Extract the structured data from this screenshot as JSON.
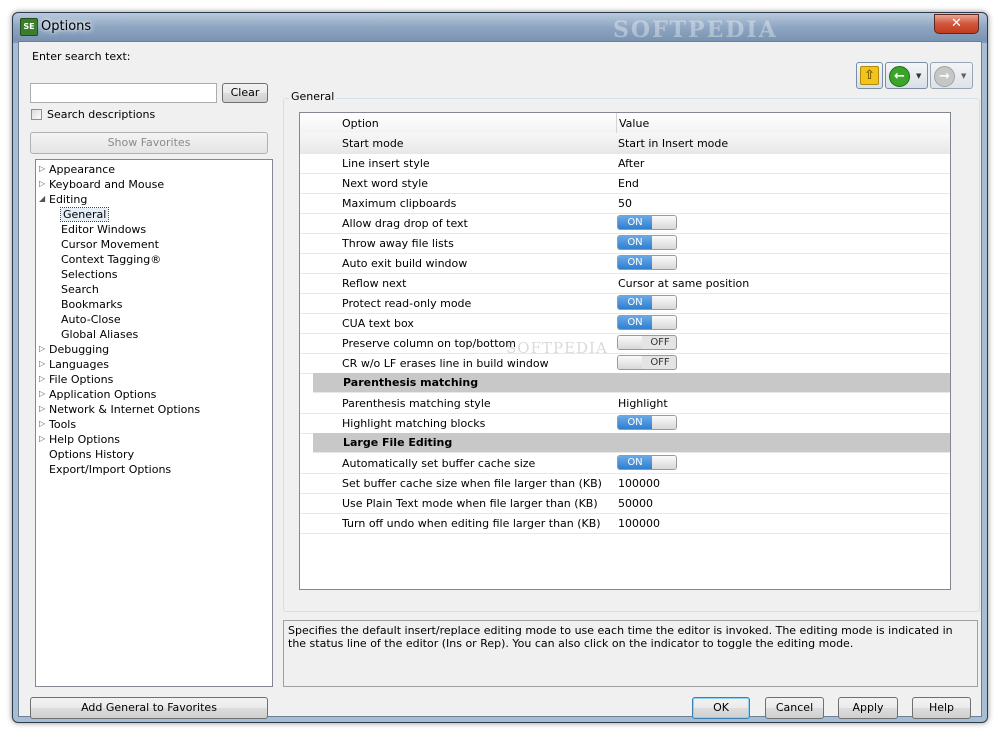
{
  "window": {
    "title": "Options",
    "icon_text": "SE",
    "watermark": "SOFTPEDIA",
    "close_glyph": "✕"
  },
  "search": {
    "label": "Enter search text:",
    "value": "",
    "clear_label": "Clear",
    "descriptions_label": "Search descriptions",
    "descriptions_checked": false
  },
  "show_favorites_label": "Show Favorites",
  "add_favorites_label": "Add General to Favorites",
  "tree": {
    "items": [
      {
        "label": "Appearance",
        "level": 0,
        "state": "collapsed"
      },
      {
        "label": "Keyboard and Mouse",
        "level": 0,
        "state": "collapsed"
      },
      {
        "label": "Editing",
        "level": 0,
        "state": "expanded"
      },
      {
        "label": "General",
        "level": 1,
        "state": "leaf",
        "selected": true
      },
      {
        "label": "Editor Windows",
        "level": 1,
        "state": "leaf"
      },
      {
        "label": "Cursor Movement",
        "level": 1,
        "state": "leaf"
      },
      {
        "label": "Context Tagging®",
        "level": 1,
        "state": "leaf"
      },
      {
        "label": "Selections",
        "level": 1,
        "state": "leaf"
      },
      {
        "label": "Search",
        "level": 1,
        "state": "leaf"
      },
      {
        "label": "Bookmarks",
        "level": 1,
        "state": "leaf"
      },
      {
        "label": "Auto-Close",
        "level": 1,
        "state": "leaf"
      },
      {
        "label": "Global Aliases",
        "level": 1,
        "state": "leaf"
      },
      {
        "label": "Debugging",
        "level": 0,
        "state": "collapsed"
      },
      {
        "label": "Languages",
        "level": 0,
        "state": "collapsed"
      },
      {
        "label": "File Options",
        "level": 0,
        "state": "collapsed"
      },
      {
        "label": "Application Options",
        "level": 0,
        "state": "collapsed"
      },
      {
        "label": "Network & Internet Options",
        "level": 0,
        "state": "collapsed"
      },
      {
        "label": "Tools",
        "level": 0,
        "state": "collapsed"
      },
      {
        "label": "Help Options",
        "level": 0,
        "state": "collapsed"
      },
      {
        "label": "Options History",
        "level": 0,
        "state": "leaf"
      },
      {
        "label": "Export/Import Options",
        "level": 0,
        "state": "leaf"
      }
    ]
  },
  "nav": {
    "up_icon": "up-arrow-icon",
    "back_icon": "back-arrow-icon",
    "forward_icon": "forward-arrow-icon",
    "up_glyph": "⇧",
    "back_glyph": "←",
    "forward_glyph": "→",
    "dropdown_glyph": "▼"
  },
  "panel": {
    "group_title": "General",
    "col_option": "Option",
    "col_value": "Value",
    "rows": [
      {
        "kind": "text",
        "name": "Start mode",
        "value": "Start in Insert mode",
        "selected": true
      },
      {
        "kind": "text",
        "name": "Line insert style",
        "value": "After"
      },
      {
        "kind": "text",
        "name": "Next word style",
        "value": "End"
      },
      {
        "kind": "text",
        "name": "Maximum clipboards",
        "value": "50"
      },
      {
        "kind": "toggle",
        "name": "Allow drag drop of text",
        "value": "ON"
      },
      {
        "kind": "toggle",
        "name": "Throw away file lists",
        "value": "ON"
      },
      {
        "kind": "toggle",
        "name": "Auto exit build window",
        "value": "ON"
      },
      {
        "kind": "text",
        "name": "Reflow next",
        "value": "Cursor at same position"
      },
      {
        "kind": "toggle",
        "name": "Protect read-only mode",
        "value": "ON"
      },
      {
        "kind": "toggle",
        "name": "CUA text box",
        "value": "ON"
      },
      {
        "kind": "toggle",
        "name": "Preserve column on top/bottom",
        "value": "OFF"
      },
      {
        "kind": "toggle",
        "name": "CR w/o LF erases line in build window",
        "value": "OFF"
      },
      {
        "kind": "section",
        "name": "Parenthesis matching"
      },
      {
        "kind": "text",
        "name": "Parenthesis matching style",
        "value": "Highlight"
      },
      {
        "kind": "toggle",
        "name": "Highlight matching blocks",
        "value": "ON"
      },
      {
        "kind": "section",
        "name": "Large File Editing"
      },
      {
        "kind": "toggle",
        "name": "Automatically set buffer cache size",
        "value": "ON"
      },
      {
        "kind": "text",
        "name": "Set buffer cache size when file larger than (KB)",
        "value": "100000"
      },
      {
        "kind": "text",
        "name": "Use Plain Text mode when file larger than (KB)",
        "value": "50000"
      },
      {
        "kind": "text",
        "name": "Turn off undo when editing file larger than (KB)",
        "value": "100000"
      }
    ],
    "description": "Specifies the default insert/replace editing mode to use each time the editor is invoked. The editing mode is indicated in the status line of the editor (Ins or Rep). You can also click on the indicator to toggle the editing mode.",
    "watermark": "SOFTPEDIA"
  },
  "buttons": {
    "ok": "OK",
    "cancel": "Cancel",
    "apply": "Apply",
    "help": "Help"
  },
  "colors": {
    "toggle_on": "#2f7fd0",
    "section_bg": "#c8c8c8",
    "nav_green": "#3aa52a",
    "nav_up_yellow": "#f2c418",
    "close_red": "#c23a1d"
  }
}
